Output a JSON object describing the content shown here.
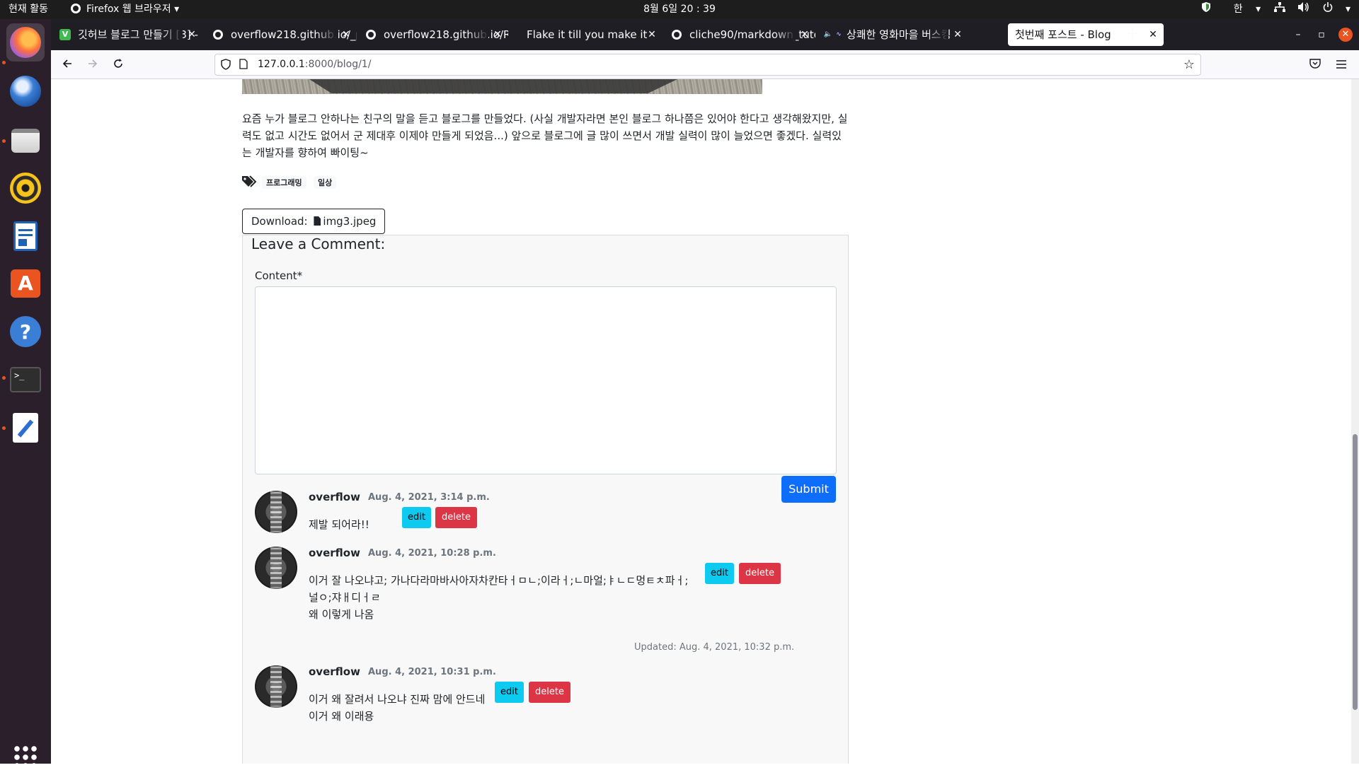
{
  "system": {
    "activities": "현재 활동",
    "app_name": "Firefox 웹 브라우저",
    "app_arrow": "▾",
    "clock": "8월 6일  20 : 39",
    "input_method": "한",
    "tray_arrow": "▾"
  },
  "dock": {
    "items": [
      "firefox-icon",
      "thunderbird-icon",
      "files-icon",
      "rhythmbox-icon",
      "writer-icon",
      "software-icon",
      "help-icon",
      "terminal-icon",
      "text-editor-icon"
    ]
  },
  "browser": {
    "tabs": [
      {
        "title": "깃허브 블로그 만들기 [3] - ≣",
        "favicon": "V"
      },
      {
        "title": "overflow218.github.io/_p",
        "favicon": "github"
      },
      {
        "title": "overflow218.github.io/RE",
        "favicon": "github"
      },
      {
        "title": "Flake it till you make it",
        "favicon": ""
      },
      {
        "title": "cliche90/markdown_tuto",
        "favicon": "github"
      },
      {
        "title": "상쾌한 영화마을 버스킹",
        "favicon": "audio"
      },
      {
        "title": "첫번째 포스트 - Blog",
        "favicon": ""
      }
    ],
    "active_tab_index": 6,
    "url_host": "127.0.0.1",
    "url_path": ":8000/blog/1/",
    "new_tab": "+",
    "min": "–",
    "max": "▫",
    "close": "✕"
  },
  "post": {
    "body": "요즘 누가 블로그 안하나는 친구의 말을 듣고 블로그를 만들었다. (사실 개발자라면 본인 블로그 하나쯤은 있어야 한다고 생각해왔지만, 실력도 없고 시간도 없어서 군 제대후 이제야 만들게 되었음...) 앞으로 블로그에 글 많이 쓰면서 개발 실력이 많이 늘었으면 좋겠다. 실력있는 개발자를 향하여 빠이팅~",
    "tags": [
      "프로그래밍",
      "일상"
    ],
    "download_label": "Download:",
    "download_file": "img3.jpeg"
  },
  "comment_form": {
    "heading": "Leave a Comment:",
    "content_label": "Content*",
    "submit_label": "Submit"
  },
  "comments": [
    {
      "author": "overflow",
      "date": "Aug. 4, 2021, 3:14 p.m.",
      "lines": [
        "제발 되어라!!"
      ],
      "edit": "edit",
      "delete": "delete",
      "updated": ""
    },
    {
      "author": "overflow",
      "date": "Aug. 4, 2021, 10:28 p.m.",
      "lines": [
        "이거 잘 나오냐고; 가나다라마바사아자차칸타ㅓㅁㄴ;이라ㅓ;ㄴ마얼;ㅑㄴㄷ멍ㅌㅊ파ㅓ;",
        "널ㅇ;쟈ㅐ디ㅓㄹ",
        "왜 이렇게 나옴"
      ],
      "edit": "edit",
      "delete": "delete",
      "updated": "Updated: Aug. 4, 2021, 10:32 p.m."
    },
    {
      "author": "overflow",
      "date": "Aug. 4, 2021, 10:31 p.m.",
      "lines": [
        "이거 왜 잘려서 나오냐 진짜 맘에 안드네",
        "이거 왜 이래용"
      ],
      "edit": "edit",
      "delete": "delete",
      "updated": ""
    }
  ]
}
